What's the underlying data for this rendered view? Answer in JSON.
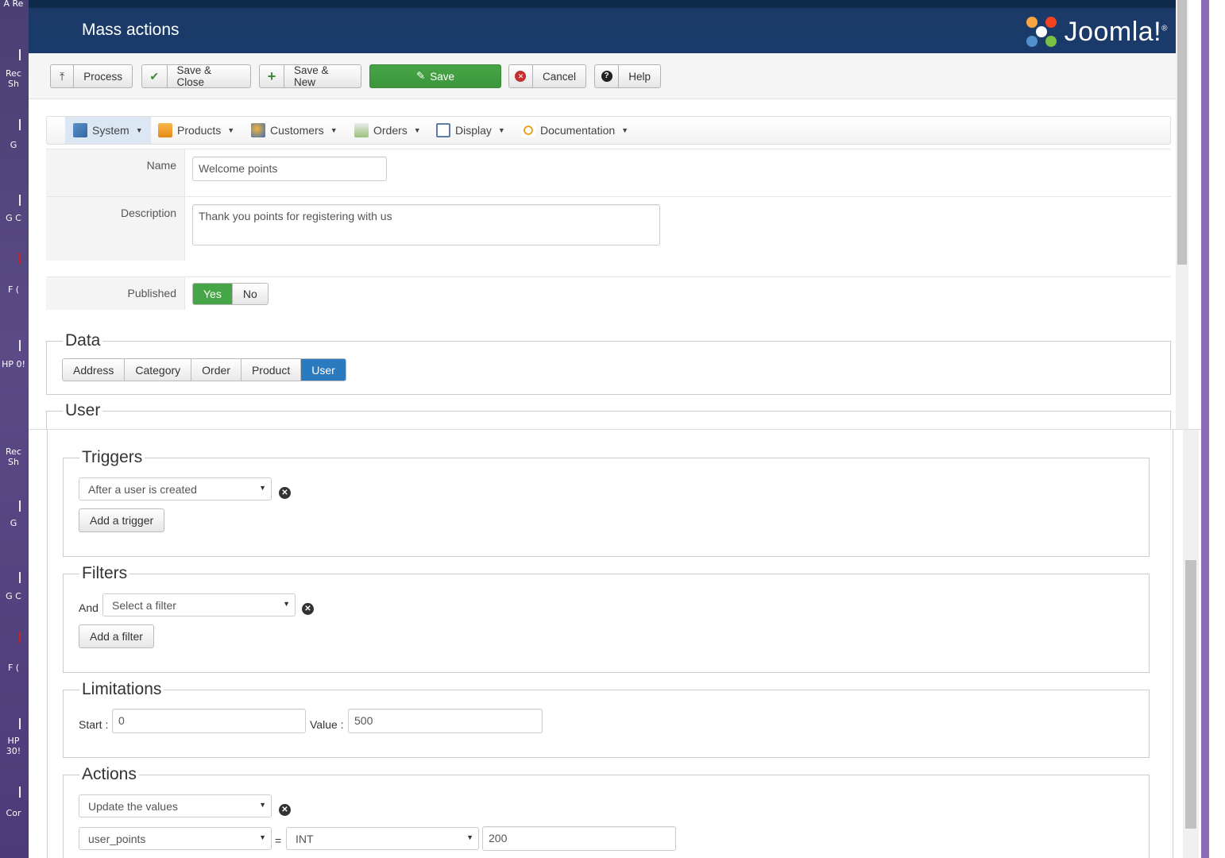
{
  "desktop": {
    "left_labels": [
      "A Re",
      "Rec Sh",
      "G",
      "G C",
      "F (",
      "HP 0!",
      "Rec Sh",
      "G",
      "G C",
      "F (",
      "HP 30!",
      "Cor"
    ]
  },
  "header": {
    "title": "Mass actions",
    "logo_text": "Joomla!",
    "logo_reg": "®"
  },
  "toolbar": {
    "process": "Process",
    "save_close": "Save & Close",
    "save_new": "Save & New",
    "save": "Save",
    "cancel": "Cancel",
    "help": "Help"
  },
  "menu": {
    "items": [
      {
        "label": "System",
        "icon": "tools-icon"
      },
      {
        "label": "Products",
        "icon": "products-icon"
      },
      {
        "label": "Customers",
        "icon": "customers-icon"
      },
      {
        "label": "Orders",
        "icon": "orders-icon"
      },
      {
        "label": "Display",
        "icon": "display-icon"
      },
      {
        "label": "Documentation",
        "icon": "documentation-icon"
      }
    ]
  },
  "form": {
    "name_label": "Name",
    "name_value": "Welcome points",
    "description_label": "Description",
    "description_value": "Thank you points for registering with us",
    "published_label": "Published",
    "yes": "Yes",
    "no": "No"
  },
  "data_section": {
    "legend": "Data",
    "options": [
      "Address",
      "Category",
      "Order",
      "Product",
      "User"
    ],
    "selected": "User"
  },
  "user_section": {
    "legend": "User"
  },
  "triggers": {
    "legend": "Triggers",
    "selected": "After a user is created",
    "add_label": "Add a trigger"
  },
  "filters": {
    "legend": "Filters",
    "and_label": "And",
    "placeholder": "Select a filter",
    "add_label": "Add a filter"
  },
  "limitations": {
    "legend": "Limitations",
    "start_label": "Start :",
    "start_value": "0",
    "value_label": "Value :",
    "value_value": "500"
  },
  "actions": {
    "legend": "Actions",
    "action_selected": "Update the values",
    "column_selected": "user_points",
    "equals": "=",
    "type_selected": "INT",
    "value": "200"
  },
  "colors": {
    "header_bg": "#1a3a6b",
    "save_green": "#46a546",
    "segment_active": "#2a7ac0"
  }
}
